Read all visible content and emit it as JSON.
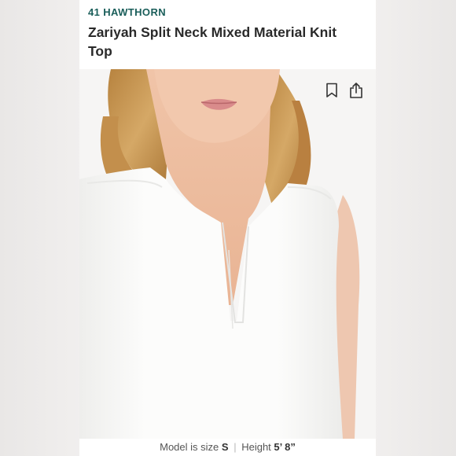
{
  "product": {
    "brand": "41 HAWTHORN",
    "title": "Zariyah Split Neck Mixed Material Knit Top"
  },
  "actions": {
    "bookmark_icon": "bookmark-icon",
    "share_icon": "share-icon"
  },
  "fit_info": {
    "model_size_label": "Model is size",
    "model_size_value": "S",
    "separator": "|",
    "height_label": "Height",
    "height_value": "5’ 8”"
  },
  "colors": {
    "brand": "#1a5e5a",
    "title": "#2a2a2a",
    "top_fabric": "#fbfbfa",
    "hair": "#c89a5a",
    "skin": "#efc3a6"
  }
}
